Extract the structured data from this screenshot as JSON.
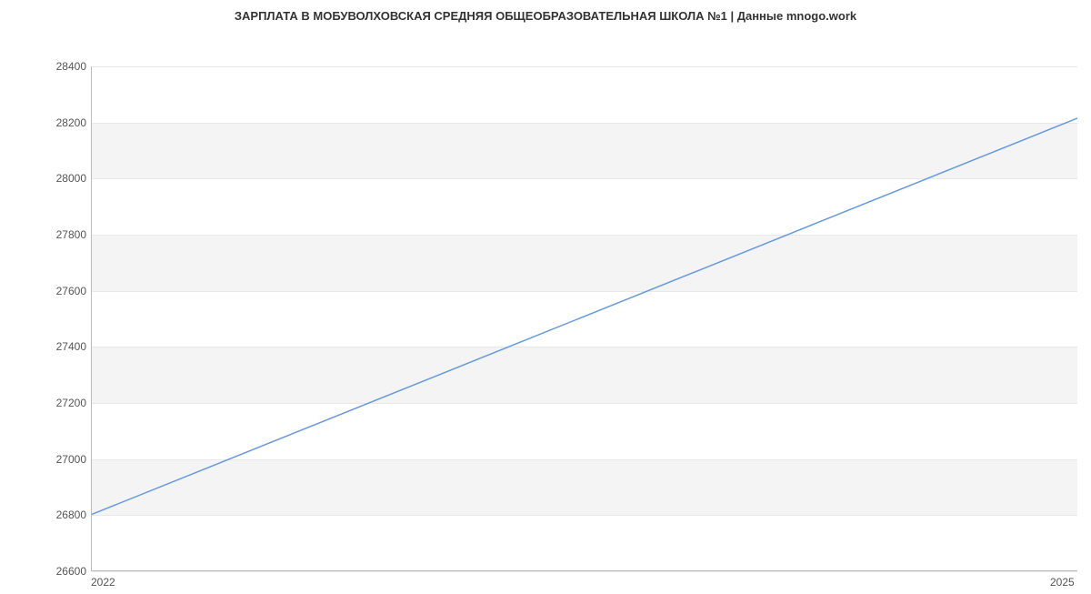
{
  "chart_data": {
    "type": "line",
    "title": "ЗАРПЛАТА В МОБУВОЛХОВСКАЯ СРЕДНЯЯ ОБЩЕОБРАЗОВАТЕЛЬНАЯ ШКОЛА №1 | Данные mnogo.work",
    "xlabel": "",
    "ylabel": "",
    "x": [
      2022,
      2025
    ],
    "values": [
      26800,
      28215
    ],
    "x_ticks": [
      2022,
      2025
    ],
    "y_ticks": [
      26600,
      26800,
      27000,
      27200,
      27400,
      27600,
      27800,
      28000,
      28200,
      28400
    ],
    "ylim": [
      26600,
      28400
    ],
    "xlim": [
      2022,
      2025
    ],
    "line_color": "#6699dd",
    "band_color": "#f4f4f4"
  }
}
